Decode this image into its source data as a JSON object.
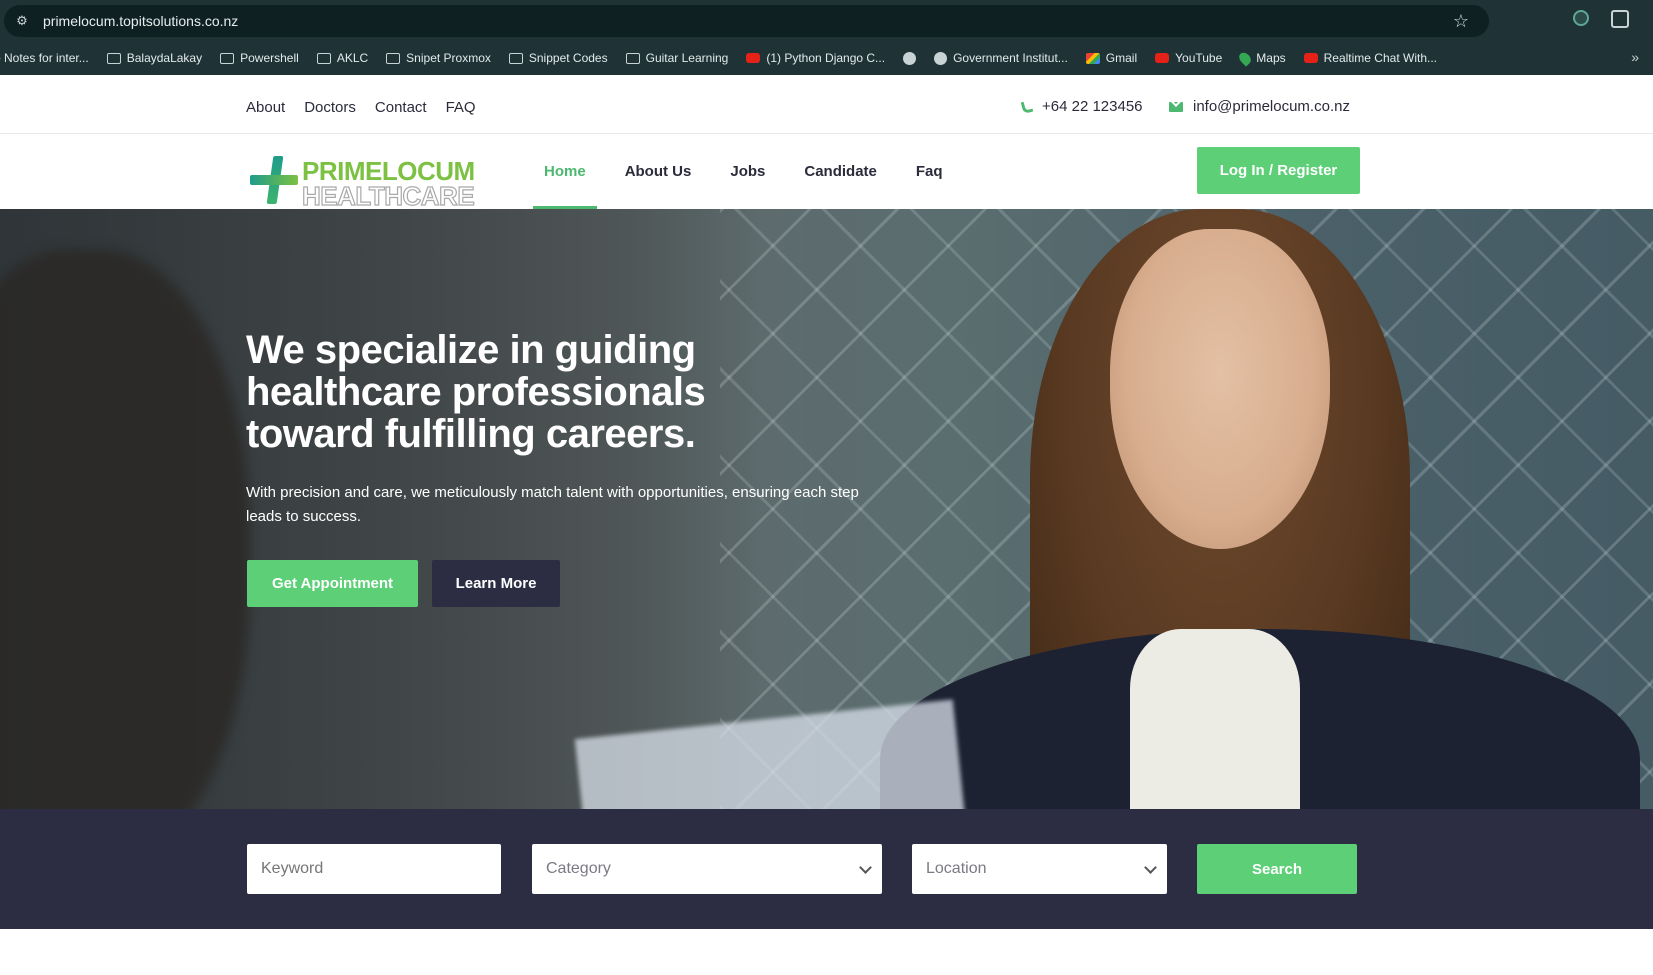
{
  "browser": {
    "url": "primelocum.topitsolutions.co.nz",
    "bookmarks": [
      {
        "label": "b Notes for inter...",
        "icon": "folder-icon"
      },
      {
        "label": "BalaydaLakay",
        "icon": "folder-icon"
      },
      {
        "label": "Powershell",
        "icon": "folder-icon"
      },
      {
        "label": "AKLC",
        "icon": "folder-icon"
      },
      {
        "label": "Snipet Proxmox",
        "icon": "folder-icon"
      },
      {
        "label": "Snippet Codes",
        "icon": "folder-icon"
      },
      {
        "label": "Guitar Learning",
        "icon": "folder-icon"
      },
      {
        "label": "(1) Python Django C...",
        "icon": "youtube-icon"
      },
      {
        "label": "",
        "icon": "globe-icon"
      },
      {
        "label": "Government Institut...",
        "icon": "globe-icon"
      },
      {
        "label": "Gmail",
        "icon": "gmail-icon"
      },
      {
        "label": "YouTube",
        "icon": "youtube-icon"
      },
      {
        "label": "Maps",
        "icon": "maps-icon"
      },
      {
        "label": "Realtime Chat With...",
        "icon": "youtube-icon"
      }
    ],
    "more_label": "»"
  },
  "topbar": {
    "links": [
      "About",
      "Doctors",
      "Contact",
      "FAQ"
    ],
    "phone": "+64 22 123456",
    "email": "info@primelocum.co.nz"
  },
  "logo": {
    "line1": "PRIMELOCUM",
    "line2": "HEALTHCARE"
  },
  "nav": {
    "items": [
      {
        "label": "Home",
        "active": true
      },
      {
        "label": "About Us",
        "active": false
      },
      {
        "label": "Jobs",
        "active": false
      },
      {
        "label": "Candidate",
        "active": false
      },
      {
        "label": "Faq",
        "active": false
      }
    ],
    "login_label": "Log In / Register"
  },
  "hero": {
    "title": "We specialize in guiding healthcare professionals toward fulfilling careers.",
    "subtitle": "With precision and care, we meticulously match talent with opportunities, ensuring each step leads to success.",
    "primary_button": "Get Appointment",
    "secondary_button": "Learn More"
  },
  "search": {
    "keyword_placeholder": "Keyword",
    "category_value": "Category",
    "location_value": "Location",
    "button_label": "Search"
  },
  "colors": {
    "accent_green": "#5ccf77",
    "dark_navy": "#2c2d43",
    "chrome_bg": "#1f3337"
  }
}
